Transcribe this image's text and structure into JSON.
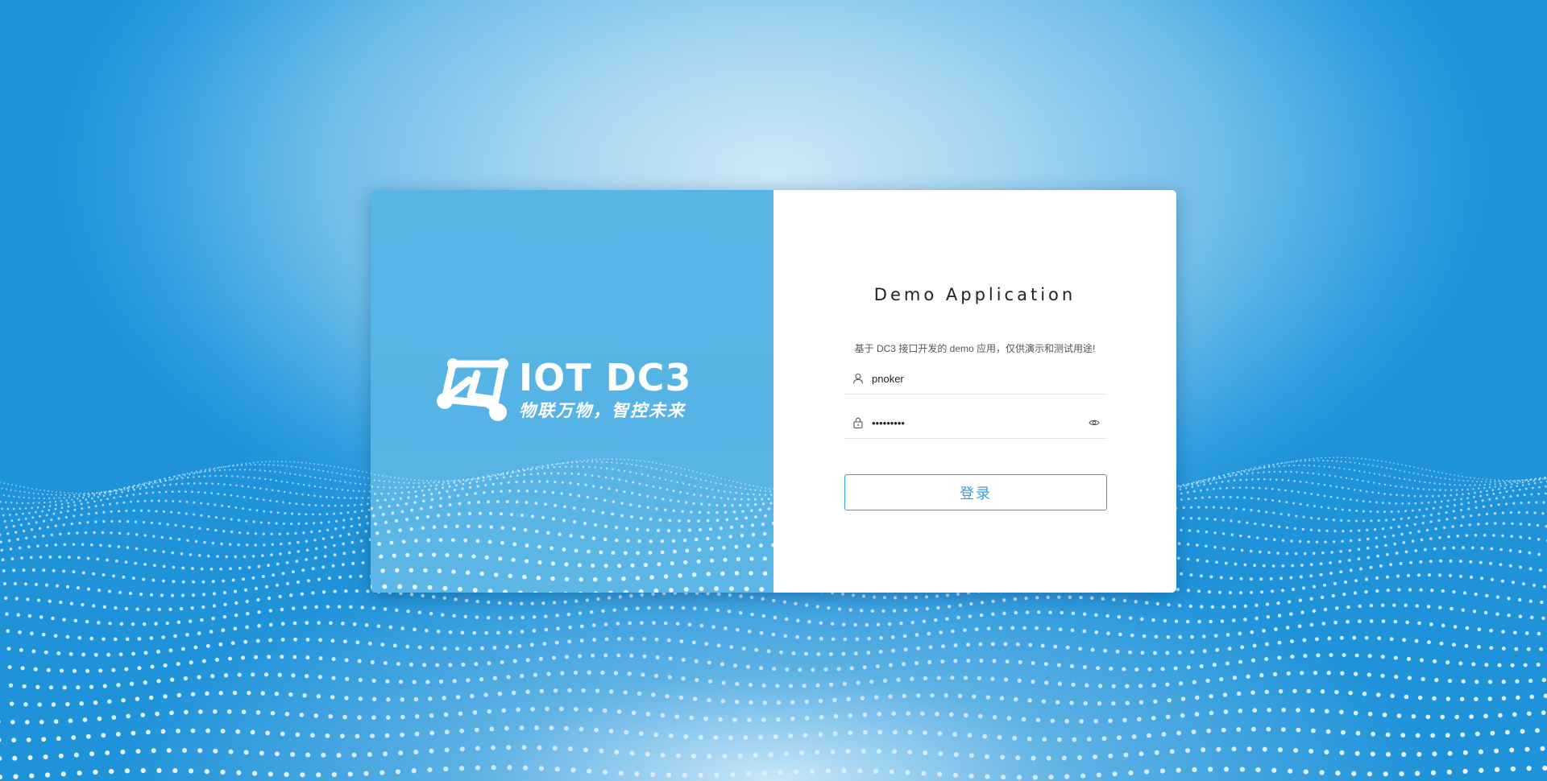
{
  "brand": {
    "title": "IOT DC3",
    "slogan": "物联万物，智控未来"
  },
  "form": {
    "title": "Demo Application",
    "description": "基于 DC3 接口开发的 demo 应用，仅供演示和测试用途!",
    "username": {
      "value": "pnoker",
      "icon": "user-icon"
    },
    "password": {
      "value": "•••••••••",
      "icon": "lock-icon",
      "toggle_icon": "eye-icon"
    },
    "login_label": "登录"
  },
  "colors": {
    "accent": "#3a9ee0",
    "brand_panel": "#56b3e5",
    "background": "#1f93da"
  }
}
